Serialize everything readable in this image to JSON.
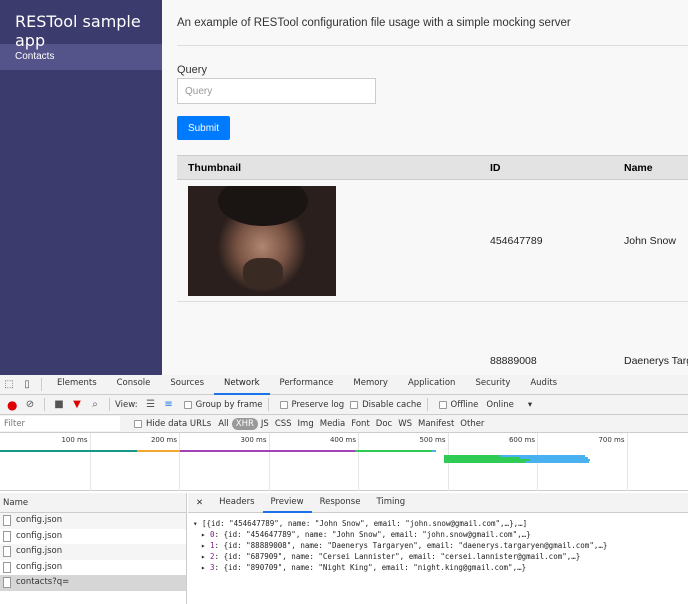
{
  "app": {
    "title": "RESTool sample app",
    "nav": [
      {
        "label": "Contacts",
        "active": true
      }
    ]
  },
  "main": {
    "description": "An example of RESTool configuration file usage with a simple mocking server",
    "query_label": "Query",
    "query_placeholder": "Query",
    "query_value": "",
    "submit_label": "Submit",
    "table": {
      "headers": [
        "Thumbnail",
        "ID",
        "Name"
      ],
      "rows": [
        {
          "thumbnail": "portrait photo",
          "id": "454647789",
          "name": "John Snow"
        },
        {
          "thumbnail": "",
          "id": "88889008",
          "name": "Daenerys Targ"
        }
      ]
    }
  },
  "colors": {
    "sidebar": "#3c3b6e",
    "sidebar_active": "#55548a",
    "accent": "#007bff",
    "record": "#e00000",
    "filter": "#e00000"
  },
  "devtools": {
    "tabs": [
      "Elements",
      "Console",
      "Sources",
      "Network",
      "Performance",
      "Memory",
      "Application",
      "Security",
      "Audits"
    ],
    "active_tab": "Network",
    "toolbar": {
      "view_label": "View:",
      "group_by_frame": "Group by frame",
      "preserve_log": "Preserve log",
      "disable_cache": "Disable cache",
      "offline": "Offline",
      "throttle": "Online"
    },
    "filter_placeholder": "Filter",
    "hide_data_urls": "Hide data URLs",
    "filter_types": [
      "All",
      "XHR",
      "JS",
      "CSS",
      "Img",
      "Media",
      "Font",
      "Doc",
      "WS",
      "Manifest",
      "Other"
    ],
    "active_filter": "XHR",
    "timeline_ticks": [
      "100 ms",
      "200 ms",
      "300 ms",
      "400 ms",
      "500 ms",
      "600 ms",
      "700 ms"
    ],
    "name_header": "Name",
    "requests": [
      "config.json",
      "config.json",
      "config.json",
      "config.json",
      "contacts?q="
    ],
    "selected_request": "contacts?q=",
    "detail_tabs": [
      "Headers",
      "Preview",
      "Response",
      "Timing"
    ],
    "active_detail_tab": "Preview",
    "preview": {
      "root": "[{id: \"454647789\", name: \"John Snow\", email: \"john.snow@gmail.com\",…},…]",
      "items": [
        {
          "key": "0",
          "value": "{id: \"454647789\", name: \"John Snow\", email: \"john.snow@gmail.com\",…}"
        },
        {
          "key": "1",
          "value": "{id: \"88889008\", name: \"Daenerys Targaryen\", email: \"daenerys.targaryen@gmail.com\",…}"
        },
        {
          "key": "2",
          "value": "{id: \"687909\", name: \"Cersei Lannister\", email: \"cersei.lannister@gmail.com\",…}"
        },
        {
          "key": "3",
          "value": "{id: \"890709\", name: \"Night King\", email: \"night.king@gmail.com\",…}"
        }
      ]
    }
  }
}
